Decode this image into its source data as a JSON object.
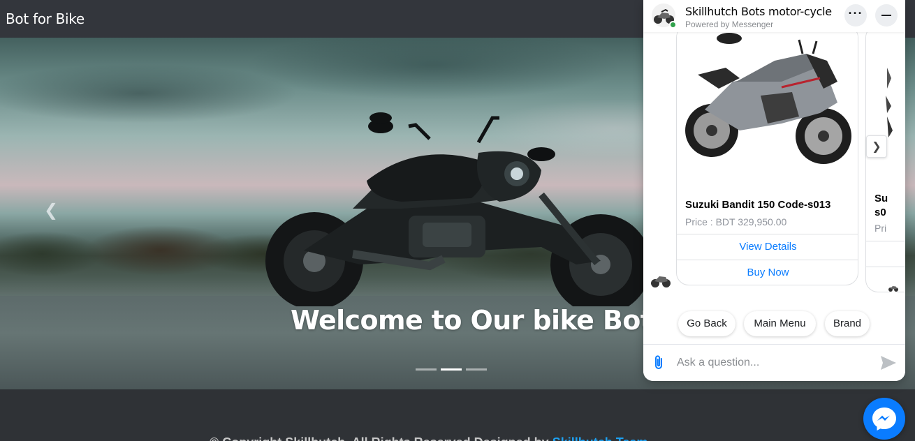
{
  "navbar": {
    "brand": "Bot for Bike"
  },
  "hero": {
    "welcome": "Welcome to Our bike Bot",
    "prev_icon": "chevron-left-icon",
    "slide_count": 3,
    "active_slide": 2
  },
  "footer": {
    "text_before_link": "© Copyright Skillhutch. All Rights Reserved Designed by ",
    "link_text": "Skillhutch Team"
  },
  "chat": {
    "title": "Skillhutch Bots motor-cycle",
    "subtitle": "Powered by Messenger",
    "more_icon": "more-horizontal-icon",
    "minimize_icon": "minimize-icon",
    "cards": [
      {
        "title": "Suzuki Bandit 150 Code-s013",
        "price": "Price : BDT 329,950.00",
        "buttons": [
          "View Details",
          "Buy Now"
        ]
      },
      {
        "title_line1": "Su",
        "title_line2": "s0",
        "price": "Pri"
      }
    ],
    "quick_replies": [
      "Go Back",
      "Main Menu",
      "Brand"
    ],
    "composer_placeholder": "Ask a question...",
    "attach_icon": "paperclip-icon",
    "send_icon": "send-icon",
    "next_icon": "chevron-right-icon"
  },
  "messenger_fab": {
    "icon": "messenger-icon"
  },
  "colors": {
    "navbar": "#33363c",
    "accent_blue": "#0a7cff",
    "online": "#31a24c",
    "footer_link": "#1da1f2"
  }
}
